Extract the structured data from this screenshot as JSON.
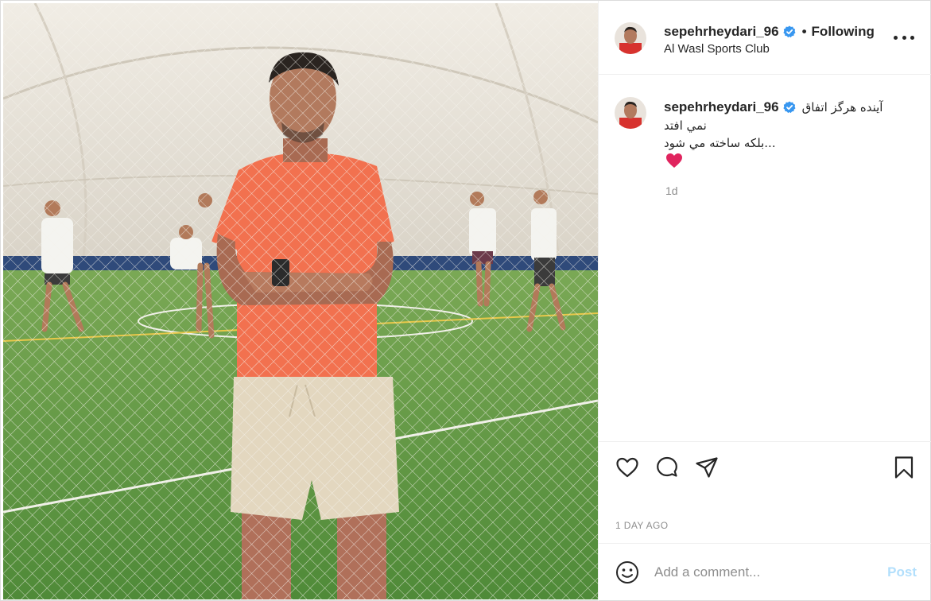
{
  "post": {
    "author": {
      "username": "sepehrheydari_96",
      "verified": true,
      "follow_state": "Following",
      "location": "Al Wasl Sports Club"
    },
    "more_icon": "more-horizontal-icon",
    "caption": {
      "line1": "آینده هرگز اتفاق",
      "line2": "نمي افتد",
      "line3": "...بلکه ساخته مي شود",
      "emoji": "red-heart",
      "time": "1d"
    },
    "actions": {
      "icons": [
        "heart-icon",
        "comment-icon",
        "share-icon",
        "bookmark-icon"
      ]
    },
    "time_ago": "1 DAY AGO",
    "comment": {
      "placeholder": "Add a comment...",
      "post_label": "Post"
    }
  },
  "colors": {
    "verified_blue": "#3897f0",
    "post_disabled": "#b2dffc",
    "muted_text": "#8e8e8e",
    "shirt_orange": "#f2714f",
    "heart_red": "#e0245e"
  }
}
